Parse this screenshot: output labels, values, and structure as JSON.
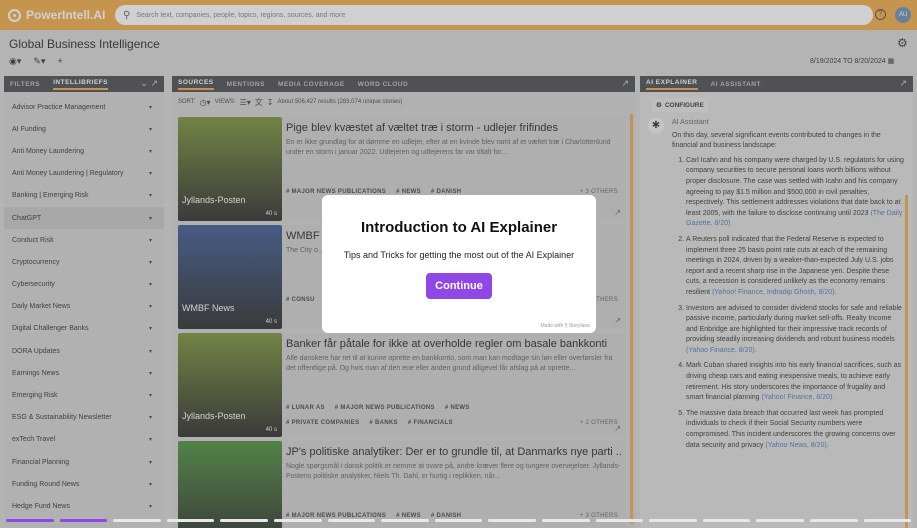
{
  "app": {
    "logo": "PowerIntell.AI",
    "search_placeholder": "Search text, companies, people, topics, regions, sources, and more",
    "help": "?",
    "avatar": "AU"
  },
  "header": {
    "title": "Global Business Intelligence",
    "date_range": "8/19/2024 TO 8/20/2024"
  },
  "left_panel": {
    "tabs": [
      "FILTERS",
      "INTELLIBRIEFS"
    ],
    "items": [
      "Advisor Practice Management",
      "AI Funding",
      "Anti Money Laundering",
      "Anti Money Laundering | Regulatory",
      "Banking | Emerging Risk",
      "ChatGPT",
      "Conduct Risk",
      "Cryptocurrency",
      "Cybersecurity",
      "Daily Market News",
      "Digital Challenger Banks",
      "DORA Updates",
      "Earnings News",
      "Emerging Risk",
      "ESG & Sustainability Newsletter",
      "exTech Travel",
      "Financial Planning",
      "Funding Round News",
      "Hedge Fund News"
    ],
    "selected_index": 5
  },
  "center_panel": {
    "tabs": [
      "SOURCES",
      "MENTIONS",
      "MEDIA COVERAGE",
      "WORD CLOUD"
    ],
    "sort_label": "SORT:",
    "views_label": "VIEWS:",
    "results": "About 506,427 results (283,074 unique stories)",
    "cards": [
      {
        "publisher": "Jyllands-Posten",
        "age": "40 s",
        "title": "Pige blev kvæstet af væltet træ i storm - udlejer frifindes",
        "desc": "En er ikke grundlag for at dømme en udlejer, efter at en kvinde blev ramt af et væltet træ i Charlottenlund under en storm i januar 2022. Udlejeren og udlejerens far var tiltalt for...",
        "tags": [
          "MAJOR NEWS PUBLICATIONS",
          "NEWS",
          "DANISH"
        ],
        "others": "+ 3 OTHERS",
        "thumb": "#6f8a2a"
      },
      {
        "publisher": "WMBF News",
        "age": "40 s",
        "title": "WMBF",
        "desc": "The City o... day's council m...",
        "tags": [
          "CONSU",
          "UNITED"
        ],
        "others": "OTHERS",
        "thumb": "#2c4d8c"
      },
      {
        "publisher": "Jyllands-Posten",
        "age": "40 s",
        "title": "Banker får påtale for ikke at overholde regler om basale bankkonti",
        "desc": "Alle danskere har ret til at kunne oprette en bankkonto, som man kan modtage sin løn eller overførsler fra det offentlige på. Og hvis man af den ene eller anden grund alligevel får afslag på at oprette...",
        "tags": [
          "LUNAR AS",
          "MAJOR NEWS PUBLICATIONS",
          "NEWS"
        ],
        "tags2": [
          "PRIVATE COMPANIES",
          "BANKS",
          "FINANCIALS"
        ],
        "others": "+ 2 OTHERS",
        "thumb": "#6f8a2a"
      },
      {
        "publisher": "",
        "age": "",
        "title": "JP's politiske analytiker: Der er to grundle til, at Danmarks nye parti ...",
        "desc": "Nogle spørgsmål i dansk politik er nemme at svare på, andre kræver flere og tungere overvejelser. Jyllands-Postens politiske analytiker, Niels Th. Dahl, er hurtig i replikken, når...",
        "tags": [
          "MAJOR NEWS PUBLICATIONS",
          "NEWS",
          "DANISH"
        ],
        "others": "+ 3 OTHERS",
        "thumb": "#3f8a30"
      }
    ]
  },
  "right_panel": {
    "tabs": [
      "AI EXPLAINER",
      "AI ASSISTANT"
    ],
    "configure": "CONFIGURE",
    "assistant_label": "AI Assistant",
    "intro": "On this day, several significant events contributed to changes in the financial and business landscape:",
    "points": [
      {
        "text": "Carl Icahn and his company were charged by U.S. regulators for using company securities to secure personal loans worth billions without proper disclosure. The case was settled with Icahn and his company agreeing to pay $1.5 million and $500,000 in civil penalties, respectively. This settlement addresses violations that date back to at least 2005, with the failure to disclose continuing until 2023",
        "src": "(The Daily Gazette, 8/20)"
      },
      {
        "text": "A Reuters poll indicated that the Federal Reserve is expected to implement three 25 basis point rate cuts at each of the remaining meetings in 2024, driven by a weaker-than-expected July U.S. jobs report and a recent sharp rise in the Japanese yen. Despite these cuts, a recession is considered unlikely as the economy remains resilient",
        "src": "(Yahoo! Finance, Indradip Ghosh, 8/20)."
      },
      {
        "text": "Investors are advised to consider dividend stocks for safe and reliable passive income, particularly during market sell-offs. Realty Income and Enbridge are highlighted for their impressive track records of providing steadily increasing dividends and robust business models",
        "src": "(Yahoo Finance, 8/20)."
      },
      {
        "text": "Mark Cuban shared insights into his early financial sacrifices, such as driving cheap cars and eating inexpensive meals, to achieve early retirement. His story underscores the importance of frugality and smart financial planning",
        "src": "(Yahoo! Finance, 8/20)."
      },
      {
        "text": "The massive data breach that occurred last week has prompted individuals to check if their Social Security numbers were compromised. This incident underscores the growing concerns over data security and privacy",
        "src": "(Yahoo News, 8/20)."
      }
    ]
  },
  "modal": {
    "title": "Introduction to AI Explainer",
    "subtitle": "Tips and Tricks for getting the most out of the AI Explainer",
    "button": "Continue",
    "made_with": "Made with § Storylane",
    "progress": 0.06
  },
  "colors": {
    "accent": "#efa53a",
    "cta": "#9146e6",
    "panel_header": "#3a3d42"
  }
}
